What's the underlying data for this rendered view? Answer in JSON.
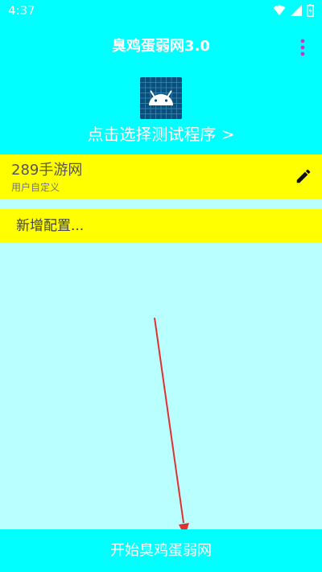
{
  "status_bar": {
    "time": "4:37",
    "icons": [
      "wifi-icon",
      "signal-icon",
      "battery-icon"
    ]
  },
  "header": {
    "title": "臭鸡蛋弱网3.0",
    "menu_icon": "more-vert-icon",
    "app_icon": "android-icon",
    "select_program": "点击选择测试程序 >"
  },
  "config_item": {
    "name": "289手游网",
    "subtitle": "用户自定义",
    "edit_icon": "pencil-icon"
  },
  "add_config": {
    "label": "新增配置..."
  },
  "start_button": {
    "label": "开始臭鸡蛋弱网"
  },
  "colors": {
    "primary": "#00ffff",
    "background": "#b9ffff",
    "highlight": "#ffff00",
    "accent": "#cc33cc",
    "annotation_arrow": "#e03030"
  }
}
